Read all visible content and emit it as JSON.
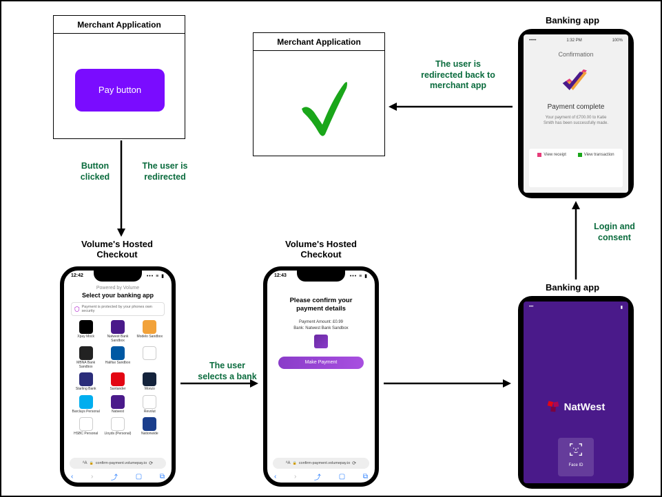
{
  "merchant1": {
    "title": "Merchant Application",
    "pay_button": "Pay button"
  },
  "merchant2": {
    "title": "Merchant Application"
  },
  "bank_confirm": {
    "label": "Banking app",
    "status_time": "1:32 PM",
    "status_batt": "100%",
    "title": "Confirmation",
    "headline": "Payment complete",
    "detail1": "Your payment of £700.00 to Katie",
    "detail2": "Smith has been successfully made.",
    "action1": "View receipt",
    "action2": "View transaction"
  },
  "vol1": {
    "label": "Volume's Hosted Checkout",
    "time": "12:42",
    "powered": "Powered by Volume",
    "title": "Select your banking app",
    "protect": "Payment is protected by your phones own security",
    "url": "confirm-payment.volumepay.io",
    "banks": [
      {
        "name": "Xpay Mock",
        "color": "#000"
      },
      {
        "name": "Natwest Bank Sandbox",
        "color": "#4a1a8a"
      },
      {
        "name": "Modelo Sandbox",
        "color": "#f2a23a"
      },
      {
        "name": "MBNA Bank Sandbox",
        "color": "#222"
      },
      {
        "name": "Halifax Sandbox",
        "color": "#0058a3"
      },
      {
        "name": "",
        "color": "transparent"
      },
      {
        "name": "Starling Bank",
        "color": "#2b2d7a"
      },
      {
        "name": "Santander",
        "color": "#e30613"
      },
      {
        "name": "Monzo",
        "color": "#14233c"
      },
      {
        "name": "Barclays Personal",
        "color": "#00aeef"
      },
      {
        "name": "Natwest",
        "color": "#4a1a8a"
      },
      {
        "name": "Revolut",
        "color": "#fff"
      },
      {
        "name": "HSBC Personal",
        "color": "#fff"
      },
      {
        "name": "Lloyds (Personal)",
        "color": "#fff"
      },
      {
        "name": "Nationwide",
        "color": "#1a3e8c"
      }
    ]
  },
  "vol2": {
    "label": "Volume's Hosted Checkout",
    "time": "12:43",
    "title": "Please confirm your payment details",
    "amount": "Payment Amount: £0.99",
    "bank": "Bank: Natwest Bank Sandbox",
    "button": "Make Payment",
    "url": "confirm-payment.volumepay.io"
  },
  "bank_login": {
    "label": "Banking app",
    "brand": "NatWest",
    "faceid": "Face ID"
  },
  "captions": {
    "c1a": "Button clicked",
    "c1b": "The user is redirected",
    "c2": "The user selects a bank",
    "c3": "Login and consent",
    "c4": "The user is redirected back to merchant app"
  }
}
